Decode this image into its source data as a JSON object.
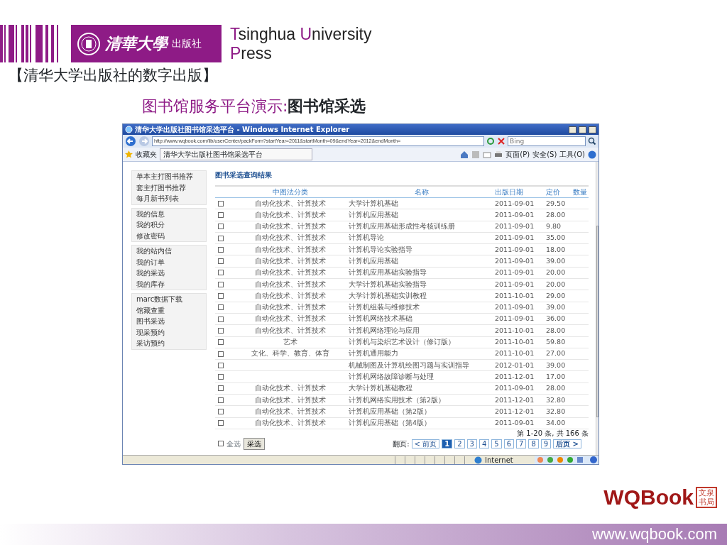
{
  "slide": {
    "logo_seal": "清華大學",
    "logo_press": "出版社",
    "logo_text": [
      "Tsinghua",
      "University",
      "Press"
    ],
    "heading": "【清华大学出版社的数字出版】",
    "subtitle": "图书馆服务平台演示:",
    "subtitle_strong": "图书馆采选",
    "brand": "WQBook",
    "brand_seal": "文泉书局",
    "footer_url": "www.wqbook.com"
  },
  "window": {
    "title": "清华大学出版社图书馆采选平台 - Windows Internet Explorer",
    "address": "http://www.wqbook.com/lib/userCenter/packForm?startYear=2011&startMonth=09&endYear=2012&endMonth=",
    "search": {
      "placeholder": "Bing"
    },
    "favorites": "收藏夹",
    "tab": "清华大学出版社图书馆采选平台",
    "menus": [
      "页面(P)",
      "安全(S)",
      "工具(O)"
    ],
    "status_zone": "Internet"
  },
  "sidebar": {
    "groups": [
      [
        "单本主打图书推荐",
        "套主打图书推荐",
        "每月新书列表"
      ],
      [
        "我的信息",
        "我的积分",
        "修改密码"
      ],
      [
        "我的站内信",
        "我的订单",
        "我的采选",
        "我的库存"
      ],
      [
        "marc数据下载",
        "馆藏查重",
        "图书采选",
        "现采预约",
        "采访预约"
      ]
    ]
  },
  "table": {
    "title": "图书采选查询结果",
    "columns": [
      "中图法分类",
      "名称",
      "出版日期",
      "定价",
      "数量"
    ],
    "rows": [
      {
        "checked": false,
        "category": "自动化技术、计算技术",
        "name": "大学计算机基础",
        "date": "2011-09-01",
        "price": "29.50"
      },
      {
        "checked": false,
        "category": "自动化技术、计算技术",
        "name": "计算机应用基础",
        "date": "2011-09-01",
        "price": "28.00"
      },
      {
        "checked": false,
        "category": "自动化技术、计算技术",
        "name": "计算机应用基础形成性考核训练册",
        "date": "2011-09-01",
        "price": "9.80"
      },
      {
        "checked": false,
        "category": "自动化技术、计算技术",
        "name": "计算机导论",
        "date": "2011-09-01",
        "price": "35.00"
      },
      {
        "checked": false,
        "category": "自动化技术、计算技术",
        "name": "计算机导论实验指导",
        "date": "2011-09-01",
        "price": "18.00"
      },
      {
        "checked": false,
        "category": "自动化技术、计算技术",
        "name": "计算机应用基础",
        "date": "2011-09-01",
        "price": "39.00"
      },
      {
        "checked": false,
        "category": "自动化技术、计算技术",
        "name": "计算机应用基础实验指导",
        "date": "2011-09-01",
        "price": "20.00"
      },
      {
        "checked": false,
        "category": "自动化技术、计算技术",
        "name": "大学计算机基础实验指导",
        "date": "2011-09-01",
        "price": "20.00"
      },
      {
        "checked": false,
        "category": "自动化技术、计算技术",
        "name": "大学计算机基础实训教程",
        "date": "2011-10-01",
        "price": "29.00"
      },
      {
        "checked": false,
        "category": "自动化技术、计算技术",
        "name": "计算机组装与维修技术",
        "date": "2011-09-01",
        "price": "39.00"
      },
      {
        "checked": false,
        "category": "自动化技术、计算技术",
        "name": "计算机网络技术基础",
        "date": "2011-09-01",
        "price": "36.00"
      },
      {
        "checked": false,
        "category": "自动化技术、计算技术",
        "name": "计算机网络理论与应用",
        "date": "2011-10-01",
        "price": "28.00"
      },
      {
        "checked": false,
        "category": "艺术",
        "name": "计算机与染织艺术设计（修订版）",
        "date": "2011-10-01",
        "price": "59.80"
      },
      {
        "checked": false,
        "category": "文化、科学、教育、体育",
        "name": "计算机通用能力",
        "date": "2011-10-01",
        "price": "27.00"
      },
      {
        "checked": false,
        "name": "机械制图及计算机绘图习题与实训指导",
        "date": "2012-01-01",
        "price": "39.00"
      },
      {
        "checked": false,
        "name": "计算机网络故障诊断与处理",
        "date": "2011-12-01",
        "price": "17.00"
      },
      {
        "checked": false,
        "category": "自动化技术、计算技术",
        "name": "大学计算机基础教程",
        "date": "2011-09-01",
        "price": "28.00"
      },
      {
        "checked": false,
        "category": "自动化技术、计算技术",
        "name": "计算机网络实用技术（第2版）",
        "date": "2011-12-01",
        "price": "32.80"
      },
      {
        "checked": false,
        "category": "自动化技术、计算技术",
        "name": "计算机应用基础（第2版）",
        "date": "2011-12-01",
        "price": "32.80"
      },
      {
        "checked": false,
        "category": "自动化技术、计算技术",
        "name": "计算机应用基础（第4版）",
        "date": "2011-09-01",
        "price": "34.00"
      }
    ],
    "select_all": {
      "label": "全选",
      "checked": false
    },
    "submit": "采选",
    "summary": "第 1-20 条, 共 166 条",
    "pager": {
      "label": "翻页:",
      "prev": "< 前页",
      "pages": [
        {
          "label": "1",
          "selected": true
        },
        {
          "label": "2",
          "selected": false
        },
        {
          "label": "3",
          "selected": false
        },
        {
          "label": "4",
          "selected": false
        },
        {
          "label": "5",
          "selected": false
        },
        {
          "label": "6",
          "selected": false
        },
        {
          "label": "7",
          "selected": false
        },
        {
          "label": "8",
          "selected": false
        },
        {
          "label": "9",
          "selected": false
        }
      ],
      "next": "后页 >"
    }
  }
}
